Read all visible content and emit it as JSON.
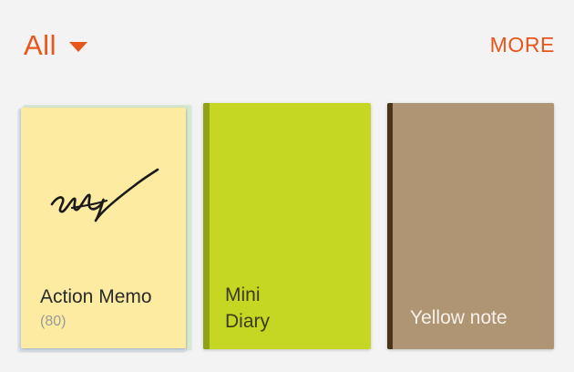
{
  "header": {
    "filter_label": "All",
    "more_label": "MORE"
  },
  "notebooks": [
    {
      "title": "Action Memo",
      "count": "(80)",
      "color": "#fdeba2",
      "icon": "handwriting-scribble-icon"
    },
    {
      "title_line1": "Mini",
      "title_line2": "Diary",
      "color": "#c6d723",
      "spine_color": "#8fa21a"
    },
    {
      "title": "Yellow note",
      "color": "#b09574",
      "spine_color": "#4b3418"
    }
  ],
  "accent_color": "#e8561a"
}
